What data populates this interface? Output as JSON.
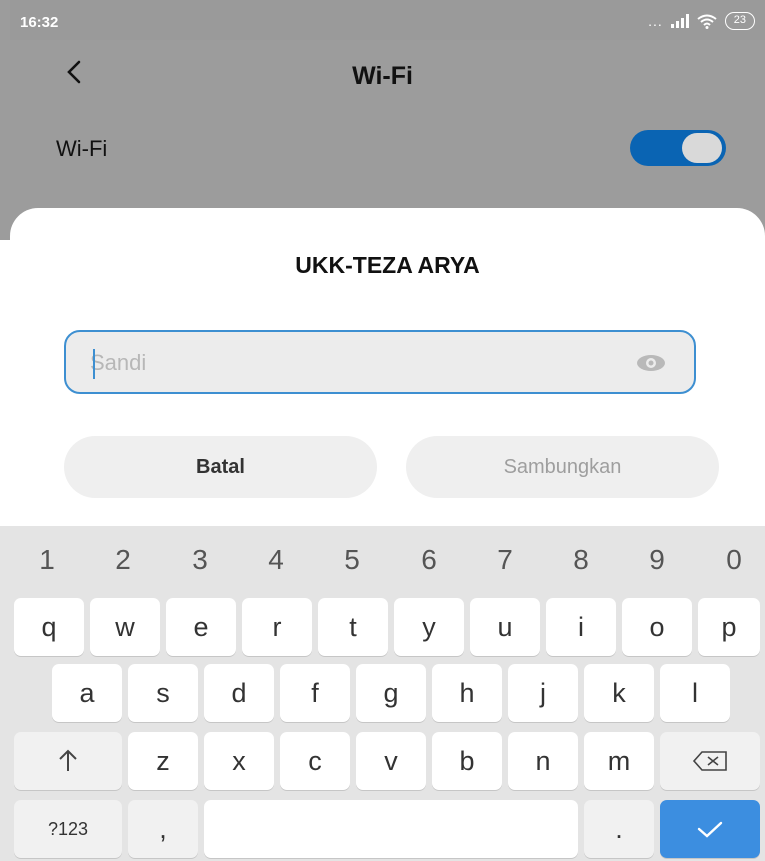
{
  "status": {
    "time": "16:32",
    "dots": "...",
    "battery": "23"
  },
  "header": {
    "title": "Wi-Fi"
  },
  "wifi_row": {
    "label": "Wi-Fi",
    "toggle_on": true
  },
  "dialog": {
    "title": "UKK-TEZA ARYA",
    "password_placeholder": "Sandi",
    "cancel_label": "Batal",
    "connect_label": "Sambungkan"
  },
  "keyboard": {
    "numbers": [
      "1",
      "2",
      "3",
      "4",
      "5",
      "6",
      "7",
      "8",
      "9",
      "0"
    ],
    "row1": [
      "q",
      "w",
      "e",
      "r",
      "t",
      "y",
      "u",
      "i",
      "o",
      "p"
    ],
    "row2": [
      "a",
      "s",
      "d",
      "f",
      "g",
      "h",
      "j",
      "k",
      "l"
    ],
    "row3": [
      "z",
      "x",
      "c",
      "v",
      "b",
      "n",
      "m"
    ],
    "symbols_label": "?123",
    "comma_label": ",",
    "period_label": "."
  },
  "colors": {
    "accent": "#0a64b3",
    "field_border": "#3d8fd1",
    "enter_key": "#3c8ee0"
  },
  "icons": {
    "back": "chevron-left-icon",
    "eye": "eye-icon",
    "shift": "shift-arrow-icon",
    "backspace": "backspace-icon",
    "enter": "checkmark-icon"
  }
}
